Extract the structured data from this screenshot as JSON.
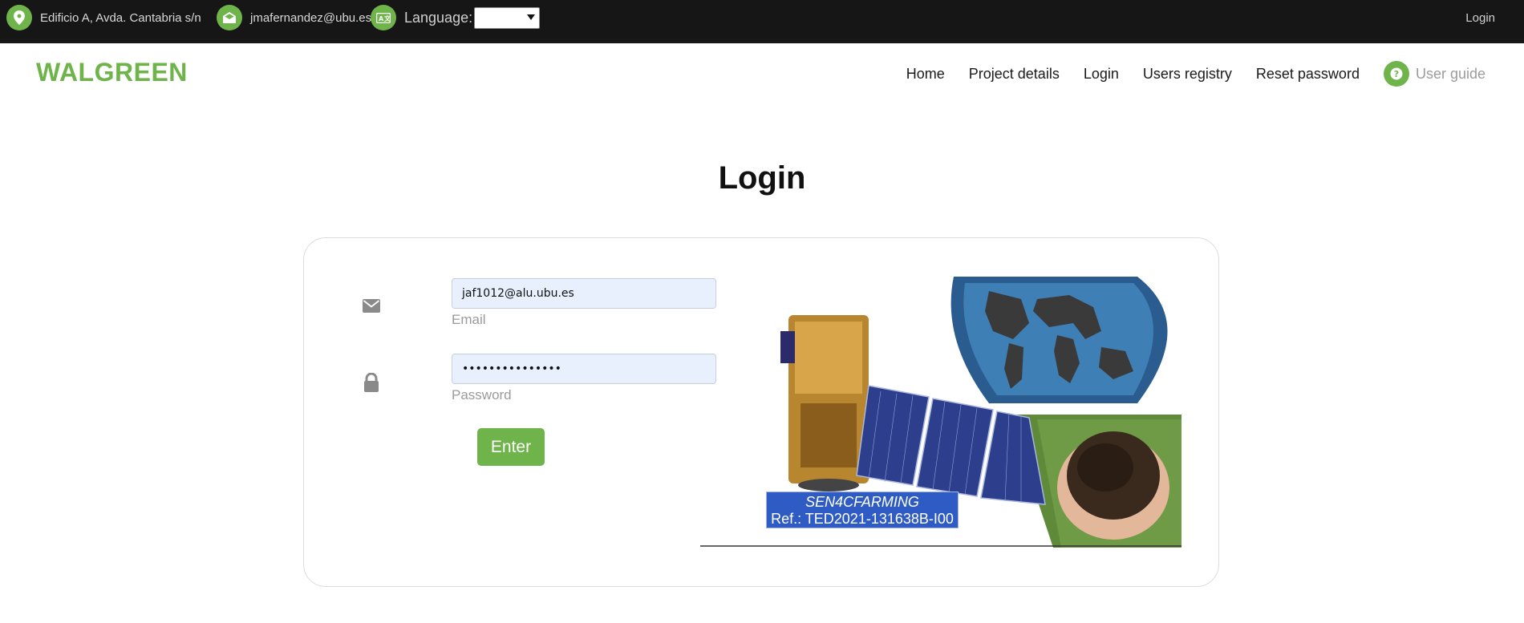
{
  "topbar": {
    "address": "Edificio A, Avda. Cantabria s/n",
    "email": "jmafernandez@ubu.es",
    "language_label": "Language:",
    "language_value": "",
    "login_link": "Login"
  },
  "brand": "WALGREEN",
  "nav": {
    "items": [
      "Home",
      "Project details",
      "Login",
      "Users registry",
      "Reset password"
    ],
    "user_guide": "User guide"
  },
  "page": {
    "title": "Login"
  },
  "form": {
    "email_value": "jaf1012@alu.ubu.es",
    "email_label": "Email",
    "password_value": "•••••••••••••••",
    "password_label": "Password",
    "submit_label": "Enter"
  },
  "illustration": {
    "project_name": "SEN4CFARMING",
    "project_ref": "Ref.: TED2021-131638B-I00"
  },
  "colors": {
    "accent": "#6fb44a",
    "topbar_bg": "#161616",
    "input_bg": "#e8f0fe",
    "ref_box": "#2f5cc4"
  }
}
